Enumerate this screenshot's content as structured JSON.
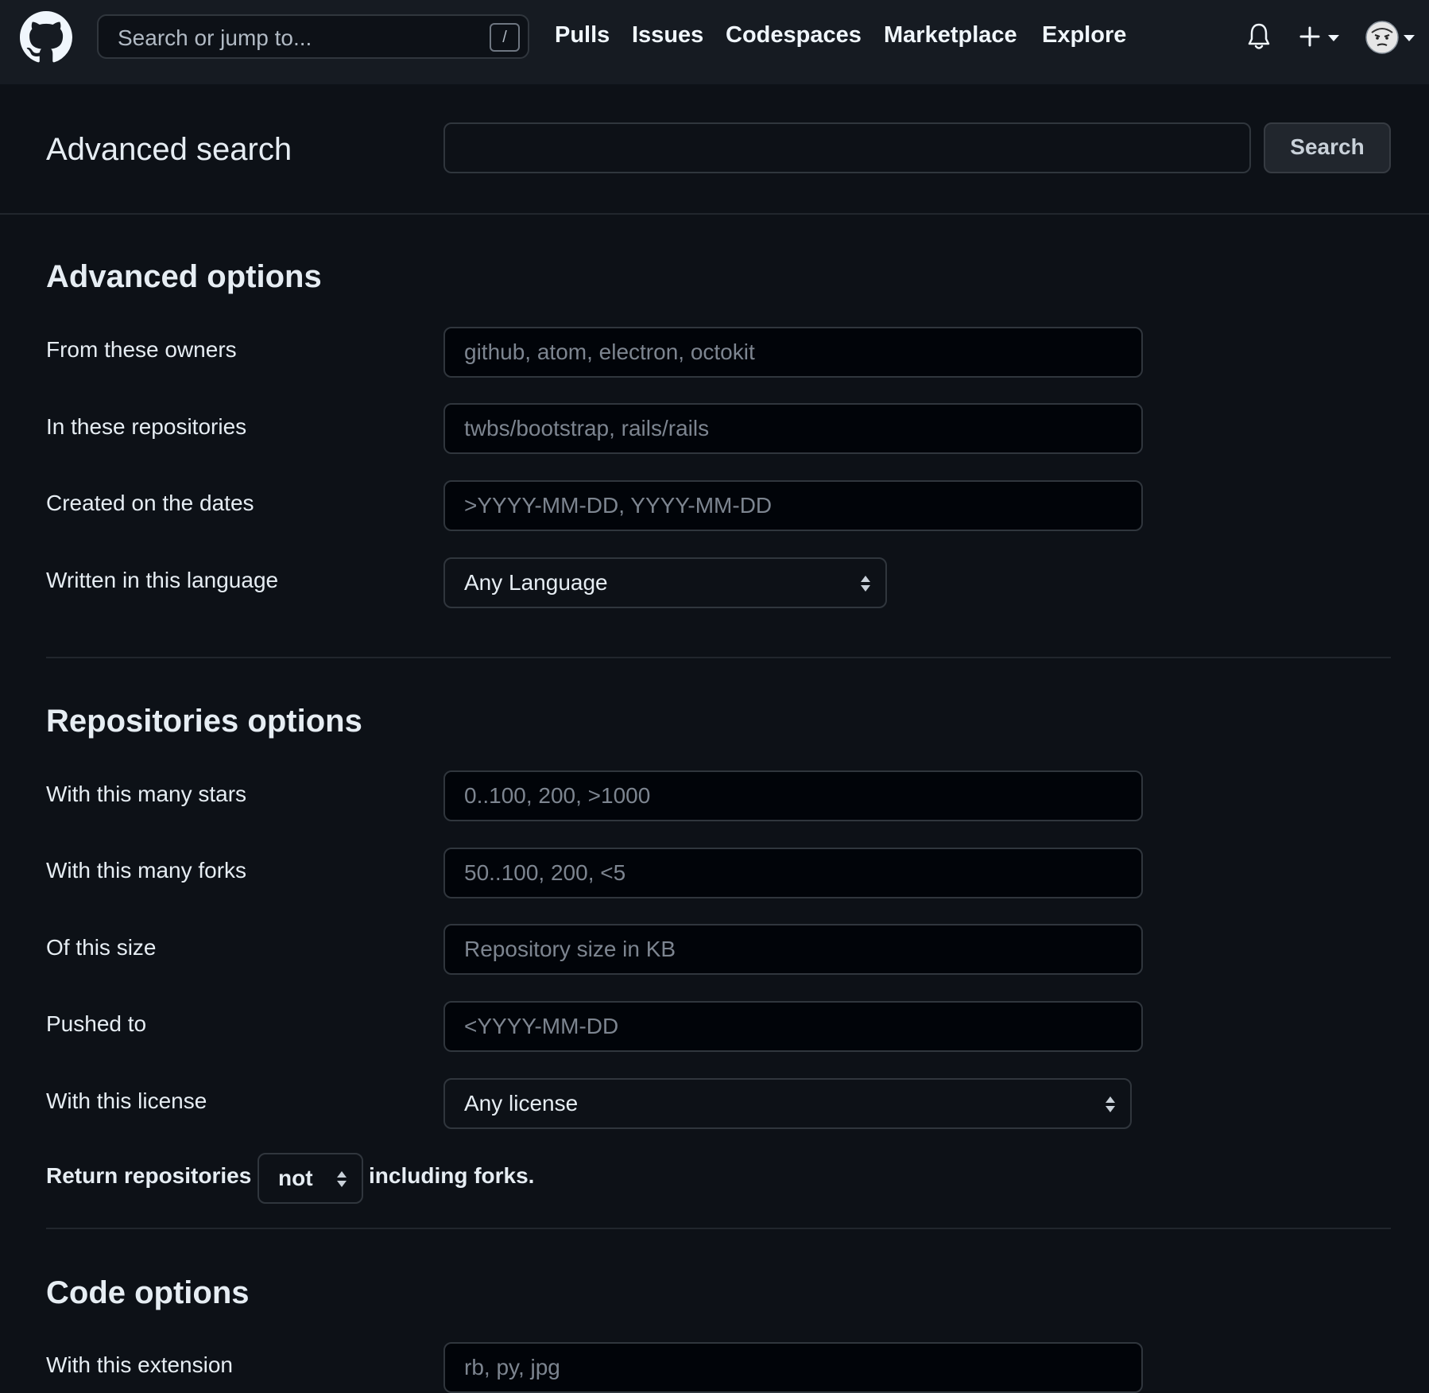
{
  "header": {
    "search_placeholder": "Search or jump to...",
    "search_shortcut": "/",
    "nav": [
      "Pulls",
      "Issues",
      "Codespaces",
      "Marketplace",
      "Explore"
    ]
  },
  "search": {
    "title": "Advanced search",
    "query_value": "",
    "button_label": "Search"
  },
  "advanced_options": {
    "title": "Advanced options",
    "owners": {
      "label": "From these owners",
      "placeholder": "github, atom, electron, octokit"
    },
    "repositories": {
      "label": "In these repositories",
      "placeholder": "twbs/bootstrap, rails/rails"
    },
    "dates": {
      "label": "Created on the dates",
      "placeholder": ">YYYY-MM-DD, YYYY-MM-DD"
    },
    "language": {
      "label": "Written in this language",
      "selected": "Any Language"
    }
  },
  "repositories_options": {
    "title": "Repositories options",
    "stars": {
      "label": "With this many stars",
      "placeholder": "0..100, 200, >1000"
    },
    "forks": {
      "label": "With this many forks",
      "placeholder": "50..100, 200, <5"
    },
    "size": {
      "label": "Of this size",
      "placeholder": "Repository size in KB"
    },
    "pushed": {
      "label": "Pushed to",
      "placeholder": "<YYYY-MM-DD"
    },
    "license": {
      "label": "With this license",
      "selected": "Any license"
    },
    "forks_toggle": {
      "prefix": "Return repositories",
      "selected": "not",
      "suffix": "including forks."
    }
  },
  "code_options": {
    "title": "Code options",
    "extension": {
      "label": "With this extension",
      "placeholder": "rb, py, jpg"
    }
  }
}
